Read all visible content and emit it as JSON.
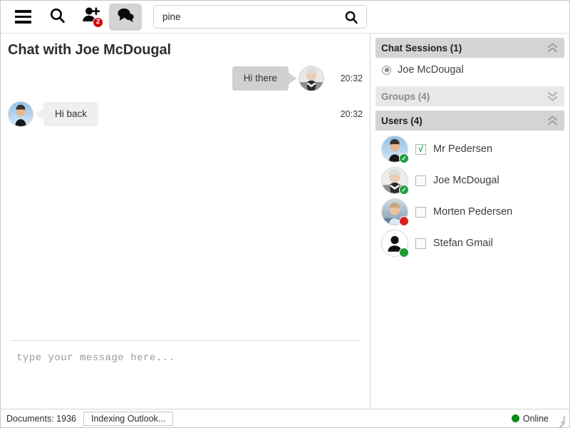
{
  "toolbar": {
    "menu_icon": "hamburger-icon",
    "search_icon": "search-icon",
    "add_user_icon": "add-person-icon",
    "add_user_badge": "2",
    "chat_icon": "chat-bubbles-icon",
    "search_value": "pine",
    "search_placeholder": "",
    "search_submit_icon": "search-icon"
  },
  "chat": {
    "title": "Chat with Joe McDougal",
    "messages": [
      {
        "direction": "out",
        "text": "Hi there",
        "time": "20:32",
        "avatar": "joe-avatar"
      },
      {
        "direction": "in",
        "text": "Hi back",
        "time": "20:32",
        "avatar": "pedersen-avatar"
      }
    ],
    "composer_placeholder": "type your message here..."
  },
  "sidebar": {
    "sections": [
      {
        "title": "Chat Sessions (1)",
        "expanded": true,
        "chevron": "chevron-double-up-icon"
      },
      {
        "title": "Groups (4)",
        "expanded": false,
        "chevron": "chevron-double-down-icon"
      },
      {
        "title": "Users (4)",
        "expanded": true,
        "chevron": "chevron-double-up-icon"
      }
    ],
    "sessions": [
      {
        "name": "Joe McDougal",
        "selected": true
      }
    ],
    "users": [
      {
        "name": "Mr Pedersen",
        "checked": true,
        "check_glyph": "√",
        "status": "online",
        "status_icon": "check-badge",
        "avatar": "pedersen-avatar"
      },
      {
        "name": "Joe McDougal",
        "checked": false,
        "check_glyph": "",
        "status": "online",
        "status_icon": "check-badge",
        "avatar": "joe-avatar"
      },
      {
        "name": "Morten Pedersen",
        "checked": false,
        "check_glyph": "",
        "status": "busy",
        "status_icon": "dot",
        "avatar": "morten-avatar"
      },
      {
        "name": "Stefan Gmail",
        "checked": false,
        "check_glyph": "",
        "status": "plain",
        "status_icon": "dot",
        "avatar": "generic-avatar"
      }
    ]
  },
  "statusbar": {
    "documents": "Documents: 1936",
    "task_button": "Indexing Outlook...",
    "connection": "Online",
    "connection_color": "#0e8a1e",
    "resize_grip_icon": "resize-grip-icon"
  },
  "colors": {
    "badge_red": "#d40511",
    "panel_header": "#d4d4d4",
    "panel_header_muted": "#e8e8e8",
    "bubble_out": "#d0d0d0",
    "bubble_in": "#efefef",
    "online_green": "#1e9e3e",
    "busy_red": "#d61f1f"
  }
}
